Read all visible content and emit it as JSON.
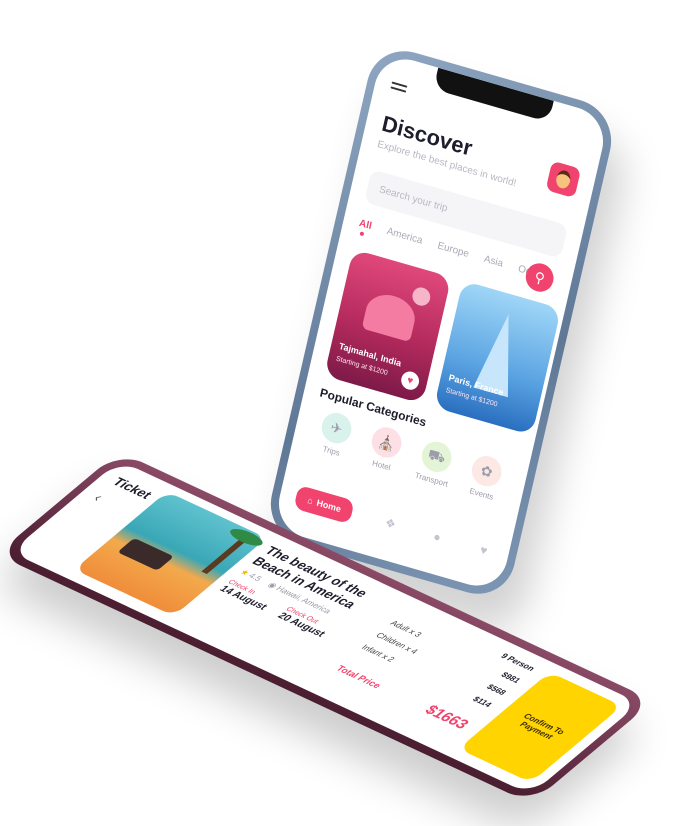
{
  "discover": {
    "title": "Discover",
    "subtitle": "Explore the best places in world!",
    "search_placeholder": "Search your trip",
    "tabs": [
      "All",
      "America",
      "Europe",
      "Asia",
      "Oceania"
    ],
    "cards": [
      {
        "name": "Tajmahal, India",
        "price": "Starting at $1200"
      },
      {
        "name": "Paris, France",
        "price": "Starting at $1200"
      }
    ],
    "popular_title": "Popular Categories",
    "categories": [
      "Trips",
      "Hotel",
      "Transport",
      "Events"
    ],
    "home_label": "Home",
    "icons": {
      "menu": "hamburger-icon",
      "avatar": "avatar",
      "search": "search-icon",
      "heart": "heart-icon",
      "home": "home-icon",
      "explore": "compass-icon",
      "profile": "user-icon",
      "favorites": "heart-icon"
    },
    "accent_color": "#f0436d"
  },
  "ticket": {
    "title": "Ticket",
    "back_icon": "chevron-left-icon",
    "place": "The beauty of the Beach in America",
    "rating": "4.5",
    "location": "Hawaii, America",
    "check_in_label": "Check In",
    "check_in": "14 August",
    "check_out_label": "Check Out",
    "check_out": "20 August",
    "persons": "9 Person",
    "rows": [
      {
        "label": "Adult x 3",
        "price": "$981"
      },
      {
        "label": "Children x 4",
        "price": "$568"
      },
      {
        "label": "Infant x 2",
        "price": "$114"
      }
    ],
    "total_label": "Total Price",
    "total": "$1663",
    "pay_label": "Confirm To Payment",
    "pay_color": "#ffd400"
  }
}
